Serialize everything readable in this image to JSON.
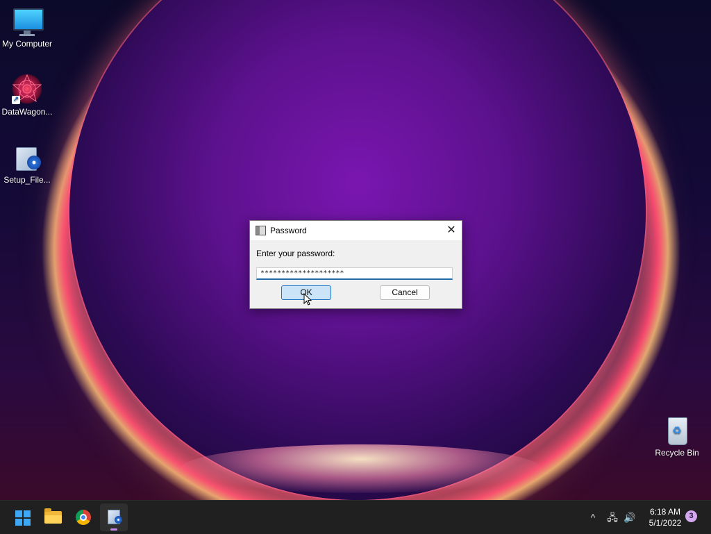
{
  "desktop": {
    "icons": [
      {
        "label": "My Computer",
        "icon": "monitor-icon"
      },
      {
        "label": "DataWagon...",
        "icon": "fractal-icon"
      },
      {
        "label": "Setup_File...",
        "icon": "installer-icon"
      },
      {
        "label": "Recycle Bin",
        "icon": "recycle-bin-icon"
      }
    ]
  },
  "dialog": {
    "title": "Password",
    "close_glyph": "✕",
    "prompt": "Enter your password:",
    "password_value": "********************",
    "ok_label": "OK",
    "cancel_label": "Cancel"
  },
  "taskbar": {
    "apps": [
      {
        "name": "start",
        "icon": "windows-logo-icon"
      },
      {
        "name": "file-explorer",
        "icon": "folder-icon"
      },
      {
        "name": "chrome",
        "icon": "chrome-icon"
      },
      {
        "name": "setup",
        "icon": "installer-icon",
        "active": true
      }
    ],
    "tray": {
      "overflow_glyph": "^",
      "network_glyph": "🖧",
      "volume_glyph": "🔊",
      "time": "6:18 AM",
      "date": "5/1/2022",
      "notification_count": "3"
    }
  },
  "colors": {
    "taskbar_bg": "#202020",
    "accent": "#1e72c4",
    "active_indicator": "#c387e8"
  }
}
